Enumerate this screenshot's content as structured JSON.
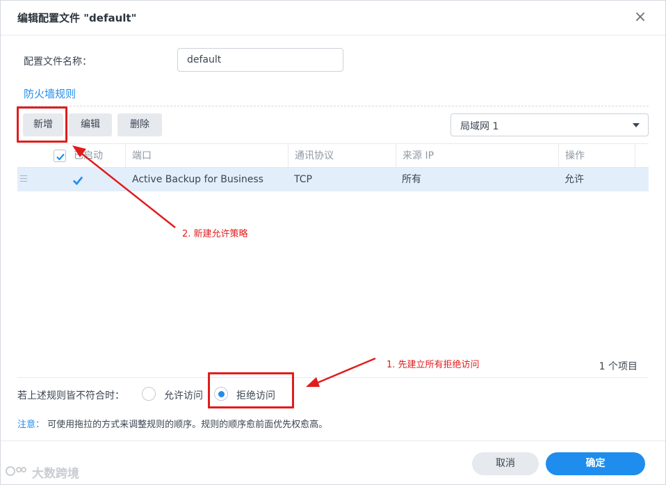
{
  "dialog": {
    "title": "编辑配置文件 \"default\"",
    "close_glyph": "×"
  },
  "profile": {
    "name_label": "配置文件名称：",
    "name_value": "default"
  },
  "section": {
    "title": "防火墙规则"
  },
  "toolbar": {
    "add_label": "新增",
    "edit_label": "编辑",
    "delete_label": "删除",
    "network_select": "局域网 1"
  },
  "table": {
    "columns": [
      "已启动",
      "端口",
      "通讯协议",
      "来源 IP",
      "操作"
    ],
    "rows": [
      {
        "enabled": true,
        "port": "Active Backup for Business",
        "protocol": "TCP",
        "source_ip": "所有",
        "action": "允许"
      }
    ],
    "count_text": "1 个项目"
  },
  "policy": {
    "label": "若上述规则皆不符合时：",
    "allow_label": "允许访问",
    "deny_label": "拒绝访问",
    "selected": "deny"
  },
  "note": {
    "prefix": "注意：",
    "text": "可使用拖拉的方式来调整规则的顺序。规则的顺序愈前面优先权愈高。"
  },
  "footer": {
    "cancel_label": "取消",
    "ok_label": "确定"
  },
  "annotations": {
    "step2": "2. 新建允许策略",
    "step1": "1. 先建立所有拒绝访问"
  },
  "watermark": "大数跨境",
  "colors": {
    "accent": "#1f8ded",
    "annotation_red": "#e11c1c",
    "selected_row": "#e3eefb"
  }
}
